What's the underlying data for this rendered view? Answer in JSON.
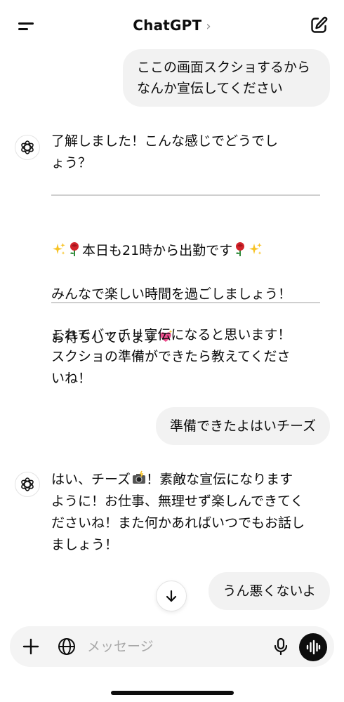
{
  "header": {
    "title": "ChatGPT",
    "chevron": "›"
  },
  "messages": {
    "user_1": "ここの画面スクショするから\nなんか宣伝してください",
    "assistant_1_intro": "了解しました！こんな感じでどうでし\nょう？",
    "promo_line1_text": "本日も21時から出勤です",
    "promo_line2": "みんなで楽しい時間を過ごしましょう！",
    "promo_line3_text": "お待ちしています",
    "assistant_1_outro": "これでバッチリ宣伝になると思います！\nスクショの準備ができたら教えてくださ\nいね！",
    "user_2": "準備できたよはいチーズ",
    "assistant_2_a": "はい、チーズ",
    "assistant_2_b": "！素敵な宣伝になります\nように！お仕事、無理せず楽しんできてく\nださいね！また何かあればいつでもお話し\nましょう！",
    "user_3": "うん悪くないよ"
  },
  "composer": {
    "placeholder": "メッセージ"
  },
  "icons": {
    "menu": "menu-icon",
    "new_chat": "new-chat-icon",
    "avatar": "chatgpt-logo-icon",
    "sparkles": "sparkles-emoji",
    "rose": "rose-emoji",
    "heart": "sparkling-heart-emoji",
    "camera": "camera-flash-emoji",
    "scroll_down": "arrow-down-icon",
    "plus": "plus-icon",
    "globe": "globe-icon",
    "mic": "mic-icon",
    "voice": "voice-mode-icon"
  },
  "colors": {
    "bubble": "#f2f2f2",
    "text": "#0d0d0d",
    "placeholder": "#a8a8a8",
    "divider": "#cfcfcf"
  }
}
